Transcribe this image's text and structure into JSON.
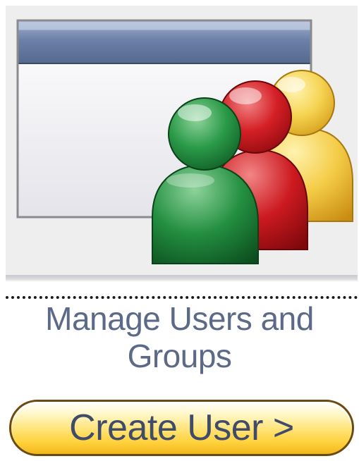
{
  "tile": {
    "icon": "manage-users-groups-icon",
    "title_line1": "Manage Users and",
    "title_line2": "Groups"
  },
  "actions": {
    "create_user_label": "Create User >"
  },
  "colors": {
    "title_text": "#5c6a87",
    "button_text": "#3f4b68",
    "button_fill": "#ffd13b",
    "window_titlebar": "#5c6f92",
    "user_green": "#1f8a3c",
    "user_red": "#c4151c",
    "user_yellow": "#f2c232"
  }
}
